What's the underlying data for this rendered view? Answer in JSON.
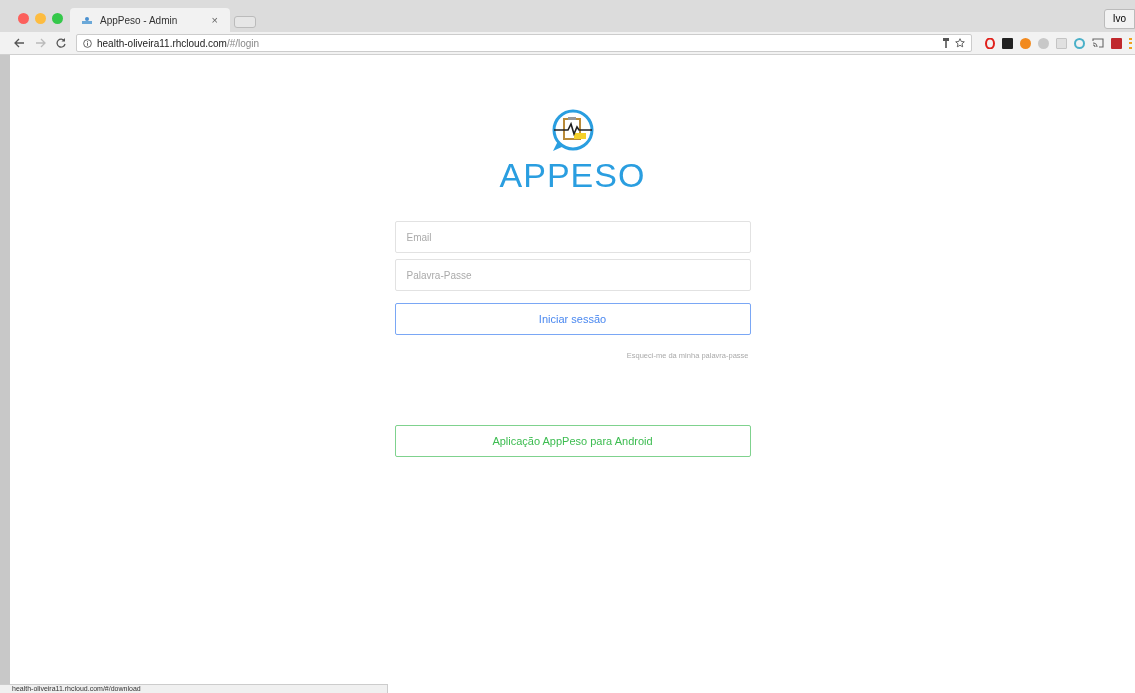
{
  "browser": {
    "tab": {
      "title": "AppPeso - Admin",
      "close": "×"
    },
    "url": {
      "host": "health-oliveira11.rhcloud.com",
      "path": "/#/login"
    },
    "profile": "Ivo"
  },
  "logo": {
    "text": "APPESO"
  },
  "form": {
    "fields": [
      {
        "placeholder": "Email"
      },
      {
        "placeholder": "Palavra-Passe"
      }
    ],
    "submit": "Iniciar sessão",
    "forgot": "Esqueci-me da minha palavra-passe",
    "android": "Aplicação AppPeso para Android"
  },
  "status_bar": "health-oliveira11.rhcloud.com/#/download"
}
